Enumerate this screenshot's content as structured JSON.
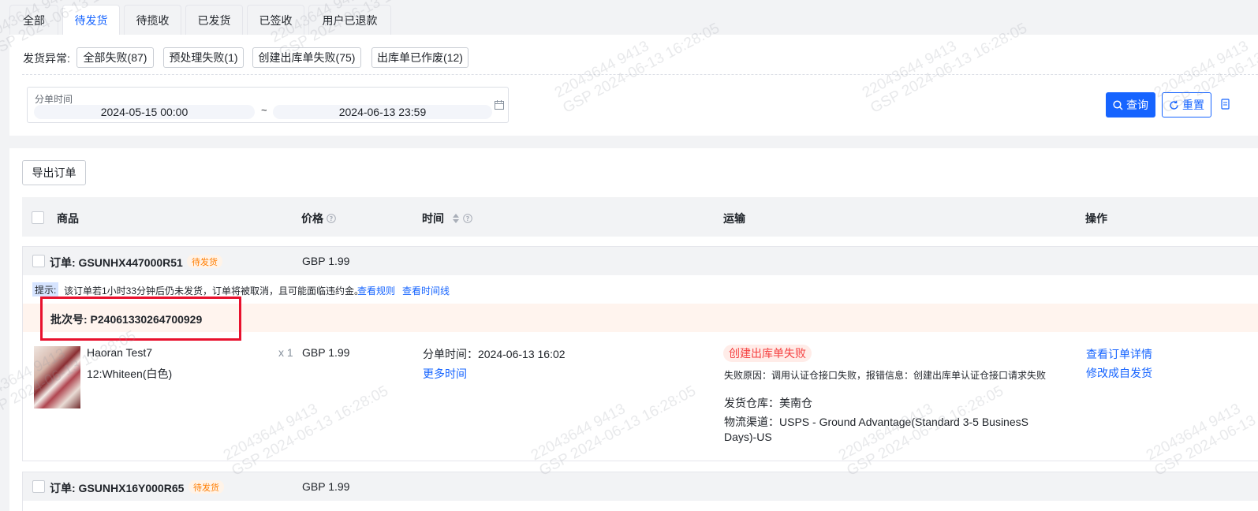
{
  "tabs": [
    {
      "label": "全部",
      "active": false
    },
    {
      "label": "待发货",
      "active": true
    },
    {
      "label": "待揽收",
      "active": false
    },
    {
      "label": "已发货",
      "active": false
    },
    {
      "label": "已签收",
      "active": false
    },
    {
      "label": "用户已退款",
      "active": false
    }
  ],
  "filter": {
    "exception_label": "发货异常:",
    "chips": [
      "全部失败(87)",
      "预处理失败(1)",
      "创建出库单失败(75)",
      "出库单已作废(12)"
    ],
    "date_label": "分单时间",
    "date_start": "2024-05-15 00:00",
    "date_sep": "~",
    "date_end": "2024-06-13 23:59",
    "query_label": "查询",
    "reset_label": "重置"
  },
  "toolbar": {
    "export_label": "导出订单"
  },
  "table": {
    "columns": {
      "product": "商品",
      "price": "价格",
      "time": "时间",
      "shipping": "运输",
      "actions": "操作"
    }
  },
  "orders": [
    {
      "order_no": "订单: GSUNHX447000R51",
      "status": "待发货",
      "price": "GBP 1.99",
      "tip_tag": "提示:",
      "tip_text": "该订单若1小时33分钟后仍未发货，订单将被取消，且可能面临违约金。",
      "tip_link_rules": "查看规则",
      "tip_link_timeline": "查看时间线",
      "batch": "批次号: P24061330264700929",
      "product_name": "Haoran Test7",
      "product_sku": "12:Whiteen(白色)",
      "qty": "x 1",
      "row_price": "GBP 1.99",
      "split_time": "分单时间：2024-06-13 16:02",
      "more_time": "更多时间",
      "fail_status": "创建出库单失败",
      "fail_reason": "失败原因：调用认证仓接口失败，报错信息：创建出库单认证仓接口请求失败",
      "warehouse": "发货仓库：美南仓",
      "channel": "物流渠道：USPS - Ground Advantage(Standard 3-5 BusinesS Days)-US",
      "action_detail": "查看订单详情",
      "action_self_ship": "修改成自发货"
    },
    {
      "order_no": "订单: GSUNHX16Y000R65",
      "status": "待发货",
      "price": "GBP 1.99"
    }
  ],
  "watermark": {
    "id": "22043644 9413",
    "stamp": "GSP 2024-06-13 16:28:05"
  },
  "colors": {
    "primary": "#1664ff",
    "danger": "#f53f3f",
    "warning": "#ff7d00",
    "highlight_box": "#e8112d"
  }
}
